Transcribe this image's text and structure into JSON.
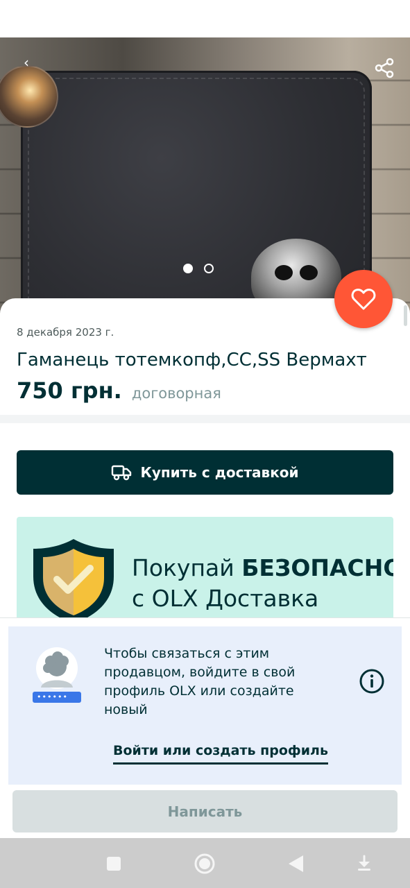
{
  "gallery": {
    "image_count": 2,
    "active_index": 0
  },
  "listing": {
    "date": "8 декабря 2023 г.",
    "title": "Гаманець тотемкопф,СС,SS Вермахт",
    "price": "750 грн.",
    "price_note": "договорная"
  },
  "actions": {
    "buy_delivery_label": "Купить с доставкой",
    "write_label": "Написать"
  },
  "banner": {
    "line1_regular": "Покупай ",
    "line1_bold": "БЕЗОПАСНО",
    "line2": "с OLX Доставка"
  },
  "login": {
    "message": "Чтобы связаться с этим продавцом, войдите в свой профиль OLX или создайте новый",
    "link_label": "Войти или создать профиль",
    "password_mask": "••••••"
  },
  "colors": {
    "primary": "#002f34",
    "favorite": "#ff5636",
    "banner_bg": "#c9f2e9",
    "panel_bg": "#e8effb"
  },
  "icons": [
    "back-arrow-icon",
    "share-icon",
    "heart-icon",
    "truck-icon",
    "shield-check-icon",
    "info-icon",
    "nav-square-icon",
    "nav-circle-icon",
    "nav-back-icon",
    "nav-down-icon"
  ]
}
